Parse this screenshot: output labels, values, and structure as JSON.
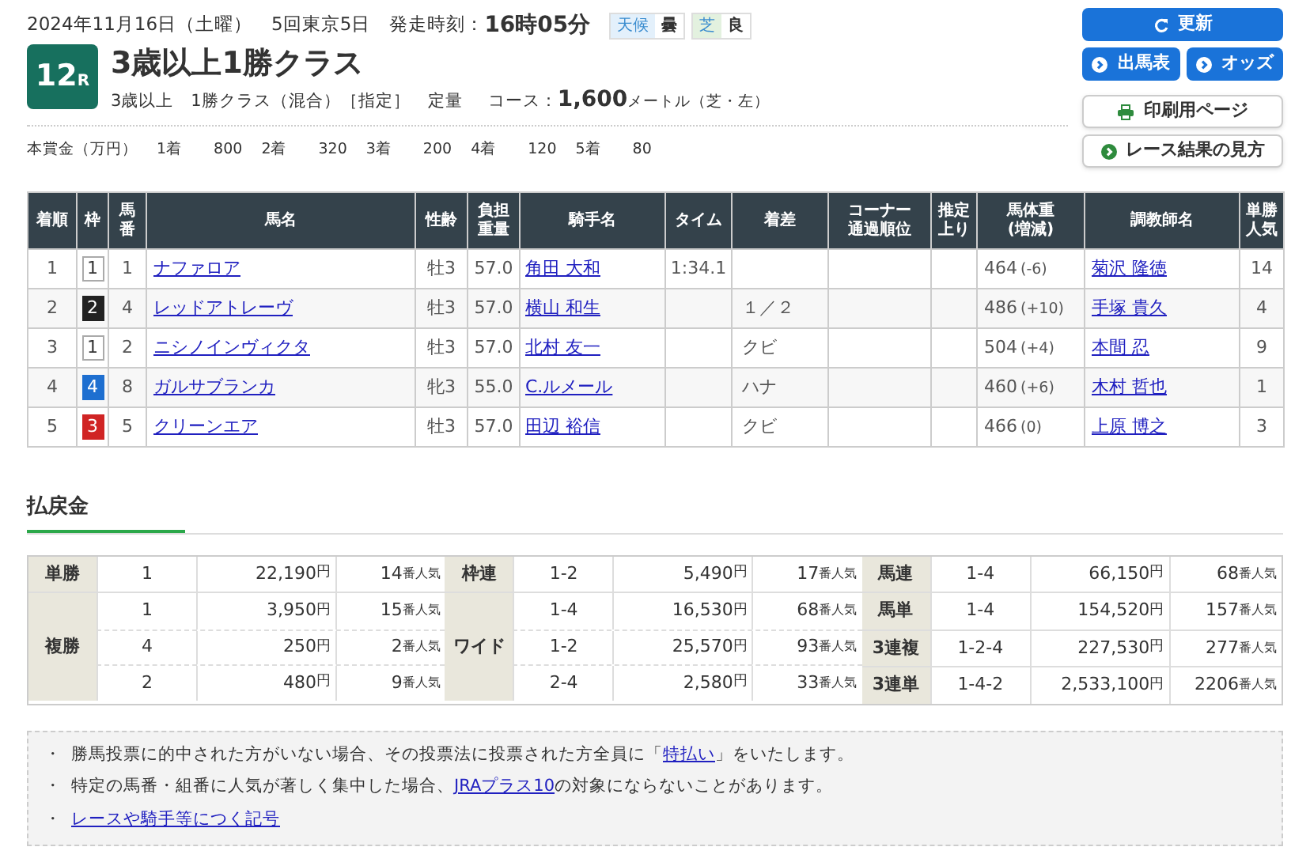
{
  "header": {
    "date": "2024年11月16日（土曜）",
    "meeting": "5回東京5日",
    "start_label": "発走時刻：",
    "start_time": "16時05分",
    "conditions": [
      {
        "label": "天候",
        "value": "曇",
        "color": "#e3f0fb"
      },
      {
        "label": "芝",
        "value": "良",
        "color": "#e3f1df"
      }
    ],
    "race_number": "12",
    "race_suffix": "R",
    "race_name": "3歳以上1勝クラス",
    "race_details": "3歳以上　1勝クラス（混合）［指定］　定量",
    "course_label": "コース：",
    "distance": "1,600",
    "distance_unit": "メートル（芝・左）",
    "prize_label": "本賞金（万円）",
    "prizes": [
      {
        "place": "1着",
        "amount": "800"
      },
      {
        "place": "2着",
        "amount": "320"
      },
      {
        "place": "3着",
        "amount": "200"
      },
      {
        "place": "4着",
        "amount": "120"
      },
      {
        "place": "5着",
        "amount": "80"
      }
    ]
  },
  "buttons": [
    {
      "label": "更新",
      "kind": "refresh"
    },
    {
      "label": "出馬表",
      "kind": "primary"
    },
    {
      "label": "オッズ",
      "kind": "primary"
    },
    {
      "label": "印刷用ページ",
      "kind": "print"
    },
    {
      "label": "レース結果の見方",
      "kind": "guide"
    }
  ],
  "results": {
    "columns": [
      "着順",
      "枠",
      "馬番",
      "馬名",
      "性齢",
      "負担重量",
      "騎手名",
      "タイム",
      "着差",
      "コーナー通過順位",
      "推定上り",
      "馬体重(増減)",
      "調教師名",
      "単勝人気"
    ],
    "rows": [
      {
        "rank": "1",
        "frame": "1",
        "color": "#ffffff",
        "number": "1",
        "horse": "ナファロア",
        "sex_age": "牡3",
        "weight": "57.0",
        "jockey": "角田 大和",
        "time": "1:34.1",
        "body_weight": "464",
        "change": "(-6)",
        "trainer": "菊沢 隆徳",
        "popularity": "14"
      },
      {
        "rank": "2",
        "frame": "2",
        "color": "#222222",
        "number": "4",
        "horse": "レッドアトレーヴ",
        "sex_age": "牡3",
        "weight": "57.0",
        "jockey": "横山 和生",
        "margin": "１／２",
        "body_weight": "486",
        "change": "(+10)",
        "trainer": "手塚 貴久",
        "popularity": "4"
      },
      {
        "rank": "3",
        "frame": "1",
        "color": "#ffffff",
        "number": "2",
        "horse": "ニシノインヴィクタ",
        "sex_age": "牡3",
        "weight": "57.0",
        "jockey": "北村 友一",
        "margin": "クビ",
        "body_weight": "504",
        "change": "(+4)",
        "trainer": "本間 忍",
        "popularity": "9"
      },
      {
        "rank": "4",
        "frame": "4",
        "color": "#1e6fd0",
        "number": "8",
        "horse": "ガルサブランカ",
        "sex_age": "牝3",
        "weight": "55.0",
        "jockey": "C.ルメール",
        "margin": "ハナ",
        "body_weight": "460",
        "change": "(+6)",
        "trainer": "木村 哲也",
        "popularity": "1"
      },
      {
        "rank": "5",
        "frame": "3",
        "color": "#d02424",
        "number": "5",
        "horse": "クリーンエア",
        "sex_age": "牡3",
        "weight": "57.0",
        "jockey": "田辺 裕信",
        "margin": "クビ",
        "body_weight": "466",
        "change": "(0)",
        "trainer": "上原 博之",
        "popularity": "3"
      }
    ]
  },
  "payouts": {
    "title": "払戻金",
    "groups": [
      {
        "bets": [
          {
            "bet": "単勝",
            "rows": [
              {
                "combo": "1",
                "amount": "22,190",
                "unit": "円",
                "rank": "14",
                "rank_unit": "番人気"
              }
            ]
          },
          {
            "bet": "複勝",
            "rows": [
              {
                "combo": "1",
                "amount": "3,950",
                "unit": "円",
                "rank": "15",
                "rank_unit": "番人気"
              },
              {
                "combo": "4",
                "amount": "250",
                "unit": "円",
                "rank": "2",
                "rank_unit": "番人気"
              },
              {
                "combo": "2",
                "amount": "480",
                "unit": "円",
                "rank": "9",
                "rank_unit": "番人気"
              }
            ]
          }
        ]
      },
      {
        "bets": [
          {
            "bet": "枠連",
            "rows": [
              {
                "combo": "1-2",
                "amount": "5,490",
                "unit": "円",
                "rank": "17",
                "rank_unit": "番人気"
              }
            ]
          },
          {
            "bet": "ワイド",
            "rows": [
              {
                "combo": "1-4",
                "amount": "16,530",
                "unit": "円",
                "rank": "68",
                "rank_unit": "番人気"
              },
              {
                "combo": "1-2",
                "amount": "25,570",
                "unit": "円",
                "rank": "93",
                "rank_unit": "番人気"
              },
              {
                "combo": "2-4",
                "amount": "2,580",
                "unit": "円",
                "rank": "33",
                "rank_unit": "番人気"
              }
            ]
          }
        ]
      },
      {
        "bets": [
          {
            "bet": "馬連",
            "rows": [
              {
                "combo": "1-4",
                "amount": "66,150",
                "unit": "円",
                "rank": "68",
                "rank_unit": "番人気"
              }
            ]
          },
          {
            "bet": "馬単",
            "rows": [
              {
                "combo": "1-4",
                "amount": "154,520",
                "unit": "円",
                "rank": "157",
                "rank_unit": "番人気"
              }
            ]
          },
          {
            "bet": "3連複",
            "rows": [
              {
                "combo": "1-2-4",
                "amount": "227,530",
                "unit": "円",
                "rank": "277",
                "rank_unit": "番人気"
              }
            ]
          },
          {
            "bet": "3連単",
            "rows": [
              {
                "combo": "1-4-2",
                "amount": "2,533,100",
                "unit": "円",
                "rank": "2206",
                "rank_unit": "番人気"
              }
            ]
          }
        ]
      }
    ]
  },
  "notes": [
    {
      "bullet": "・",
      "before": "勝馬投票に的中された方がいない場合、その投票法に投票された方全員に「",
      "link": "特払い",
      "after": "」をいたします。"
    },
    {
      "bullet": "・",
      "before": "特定の馬番・組番に人気が著しく集中した場合、",
      "link": "JRAプラス10",
      "after": "の対象にならないことがあります。"
    },
    {
      "bullet": "・",
      "link": "レースや騎手等につく記号"
    }
  ]
}
